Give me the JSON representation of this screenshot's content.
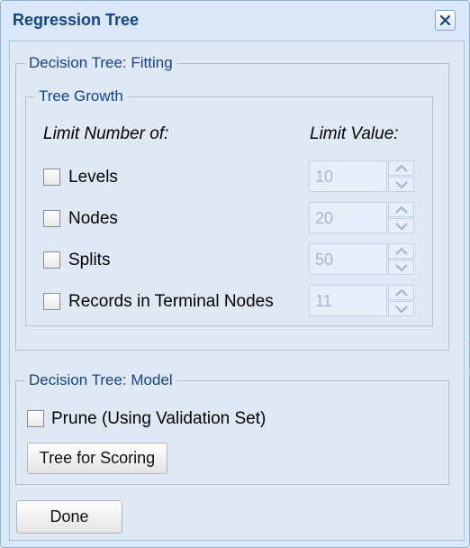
{
  "dialog": {
    "title": "Regression Tree",
    "close_icon": "close-icon"
  },
  "fitting": {
    "legend": "Decision Tree: Fitting",
    "growth": {
      "legend": "Tree Growth",
      "col_limit_number": "Limit Number of:",
      "col_limit_value": "Limit Value:",
      "rows": [
        {
          "label": "Levels",
          "checked": false,
          "value": "10"
        },
        {
          "label": "Nodes",
          "checked": false,
          "value": "20"
        },
        {
          "label": "Splits",
          "checked": false,
          "value": "50"
        },
        {
          "label": "Records in Terminal Nodes",
          "checked": false,
          "value": "11"
        }
      ]
    }
  },
  "model": {
    "legend": "Decision Tree: Model",
    "prune_label": "Prune (Using Validation Set)",
    "prune_checked": false,
    "tree_for_scoring_label": "Tree for Scoring"
  },
  "footer": {
    "done_label": "Done"
  },
  "colors": {
    "title": "#15428b",
    "dialog_bg": "#d9e7f8",
    "disabled_text": "#a9b7c7"
  }
}
